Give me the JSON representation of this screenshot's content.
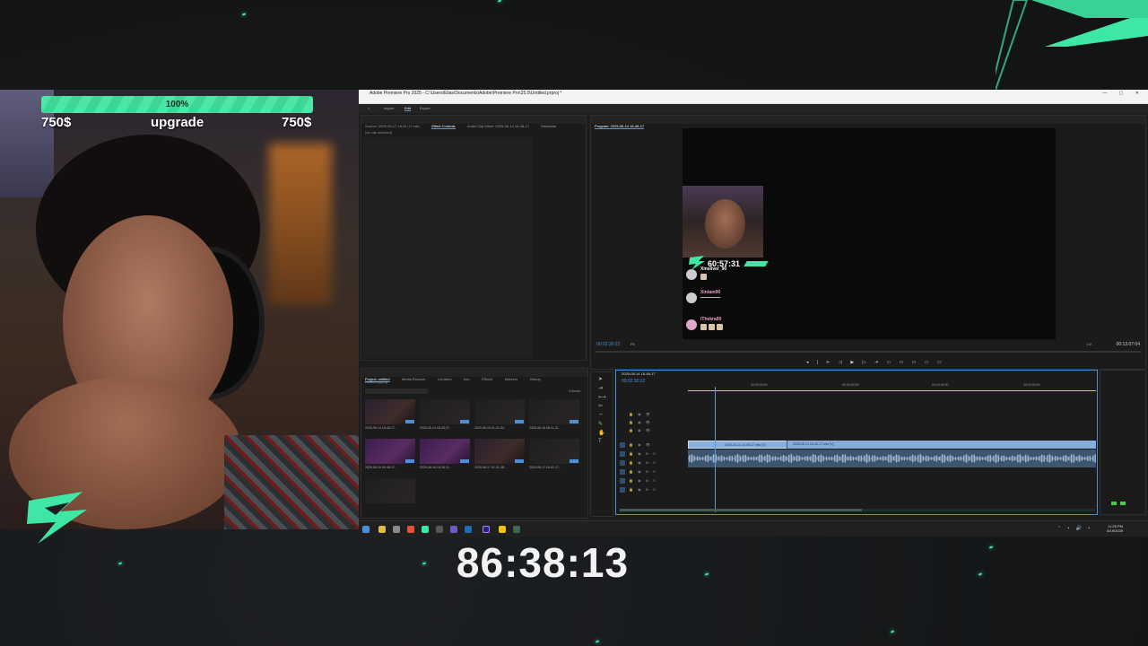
{
  "overlay": {
    "progress_percent": 100,
    "progress_label": "100%",
    "goal_left": "750$",
    "goal_title": "upgrade",
    "goal_right": "750$",
    "timer": "86:38:13",
    "accent_color": "#3ee8a4"
  },
  "premiere": {
    "title": "Adobe Premiere Pro 2025 - C:\\Users\\Elias\\Documents\\Adobe\\Premiere Pro\\25.0\\Untitled.prproj *",
    "menu": [
      "File",
      "Edit",
      "Clip",
      "Sequence",
      "Markers",
      "Graphics and Titles",
      "View",
      "Window",
      "Help"
    ],
    "workspaces": [
      "Import",
      "Edit",
      "Export"
    ],
    "source_tabs": [
      "Source: 2025-06-17 18-41-17.mkv",
      "Effect Controls",
      "Audio Clip Mixer: 2025-06-14 16-48-17",
      "Metadata"
    ],
    "effect_controls_text": "(no clip selected)",
    "program_tab": "Program: 2025-06-14 16-48-17",
    "program_timecode": "00:02:30:22",
    "program_fit": "Fit",
    "program_ratio": "1/2",
    "program_duration": "00:13:07:04",
    "stream_preview": {
      "timer": "60:57:31",
      "chat": [
        {
          "name": "Xinsilver_90",
          "message": ""
        },
        {
          "name": "Xintam90",
          "message": "▪▪▪▪▪▪▪▪▪▪▪▪▪▪▪▪▪▪▪▪▪▪▪▪▪▪▪▪▪▪▪▪▪▪▪▪▪▪▪▪▪▪▪▪▪▪▪▪▪▪▪▪▪▪▪▪▪▪▪▪▪▪▪▪▪▪▪▪▪▪▪▪▪▪▪▪▪▪▪▪"
        },
        {
          "name": "iThekra90",
          "message": ""
        }
      ]
    },
    "project_tabs": [
      "Project: untitled",
      "Media Browser",
      "Libraries",
      "Info",
      "Effects",
      "Markers",
      "History"
    ],
    "project_path": "Untitled.prproj",
    "project_count": "9 items",
    "thumbnails": [
      {
        "label": "2025-06-14 16-48-17..",
        "style": "normal"
      },
      {
        "label": "2025-06-14 18-28-37..",
        "style": "dark"
      },
      {
        "label": "2025-06-15 01-21-54..",
        "style": "dark"
      },
      {
        "label": "2025-06-16 08-11-21..",
        "style": "dark"
      },
      {
        "label": "2025-06-16 06-48-17..",
        "style": "purple"
      },
      {
        "label": "2025-06-16 18-28-11..",
        "style": "purple"
      },
      {
        "label": "2025-06-17 01-21-38..",
        "style": "normal"
      },
      {
        "label": "2025-06-17 18-41-17..",
        "style": "dark"
      },
      {
        "label": "",
        "style": "dark"
      }
    ],
    "timeline_tab": "2025-06-14 16-48-17",
    "timeline_timecode": "00:02:30:22",
    "ruler_labels": [
      "00:00:00:00",
      "00:05:00:00",
      "00:10:00:00",
      "00:15:00:00"
    ],
    "clip_label": "2025-06-14 16-48-17.mkv [V]",
    "clip_label2": "2025-06-14 16-48-17.mkv [V]",
    "taskbar_time": "11:25 PM",
    "taskbar_date": "6/19/2025"
  }
}
